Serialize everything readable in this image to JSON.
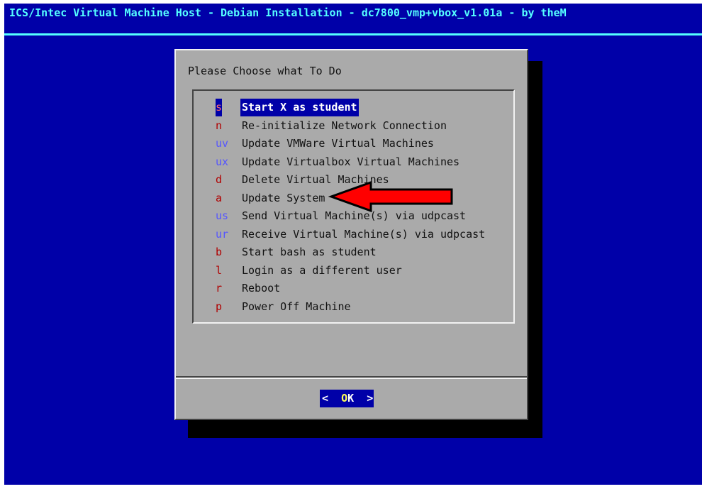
{
  "window": {
    "title": "ICS/Intec Virtual Machine Host - Debian Installation - dc7800_vmp+vbox_v1.01a - by theM"
  },
  "dialog": {
    "title": "Please Choose what To Do",
    "menu_items": [
      {
        "tag": "s",
        "label": "Start X as student",
        "tag_color": "red",
        "selected": true
      },
      {
        "tag": "n",
        "label": "Re-initialize Network Connection",
        "tag_color": "red"
      },
      {
        "tag": "uv",
        "label": "Update VMWare Virtual Machines",
        "tag_color": "blue"
      },
      {
        "tag": "ux",
        "label": "Update Virtualbox Virtual Machines",
        "tag_color": "blue"
      },
      {
        "tag": "d",
        "label": "Delete Virtual Machines",
        "tag_color": "red"
      },
      {
        "tag": "a",
        "label": "Update System",
        "tag_color": "red"
      },
      {
        "tag": "us",
        "label": "Send Virtual Machine(s) via udpcast",
        "tag_color": "blue"
      },
      {
        "tag": "ur",
        "label": "Receive Virtual Machine(s) via udpcast",
        "tag_color": "blue"
      },
      {
        "tag": "b",
        "label": "Start bash as student",
        "tag_color": "red"
      },
      {
        "tag": "l",
        "label": "Login as a different user",
        "tag_color": "red"
      },
      {
        "tag": "r",
        "label": "Reboot",
        "tag_color": "red"
      },
      {
        "tag": "p",
        "label": "Power Off Machine",
        "tag_color": "red"
      }
    ],
    "ok_button": {
      "open": "<",
      "accel": "O",
      "rest": "K",
      "close": ">"
    }
  },
  "colors": {
    "screen_bg": "#0000a8",
    "title_text": "#55ffff",
    "dialog_bg": "#aaaaaa",
    "arrow_fill": "#ff0000"
  },
  "annotation": {
    "type": "arrow",
    "points_to": "Update System"
  }
}
